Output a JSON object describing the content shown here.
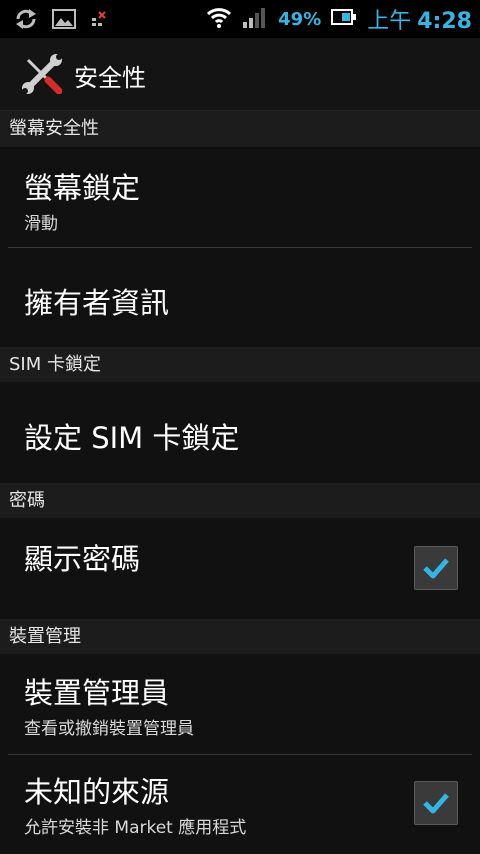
{
  "status_bar": {
    "battery_percent": "49%",
    "time_ampm": "上午",
    "time": "4:28",
    "icons": [
      "sync-icon",
      "picture-icon",
      "sim-error-icon",
      "wifi-icon",
      "signal-icon",
      "battery-icon"
    ]
  },
  "title_bar": {
    "title": "安全性",
    "icon": "tools-icon"
  },
  "sections": [
    {
      "header": "螢幕安全性",
      "items": [
        {
          "title": "螢幕鎖定",
          "summary": "滑動"
        },
        {
          "title": "擁有者資訊",
          "summary": ""
        }
      ]
    },
    {
      "header": "SIM 卡鎖定",
      "items": [
        {
          "title": "設定 SIM 卡鎖定",
          "summary": ""
        }
      ]
    },
    {
      "header": "密碼",
      "items": [
        {
          "title": "顯示密碼",
          "summary": "",
          "checked": true
        }
      ]
    },
    {
      "header": "裝置管理",
      "items": [
        {
          "title": "裝置管理員",
          "summary": "查看或撤銷裝置管理員"
        },
        {
          "title": "未知的來源",
          "summary": "允許安裝非 Market 應用程式",
          "checked": true
        }
      ]
    }
  ],
  "colors": {
    "accent": "#33b5e5",
    "background": "#111111",
    "header_bg": "#1c1c1c"
  }
}
